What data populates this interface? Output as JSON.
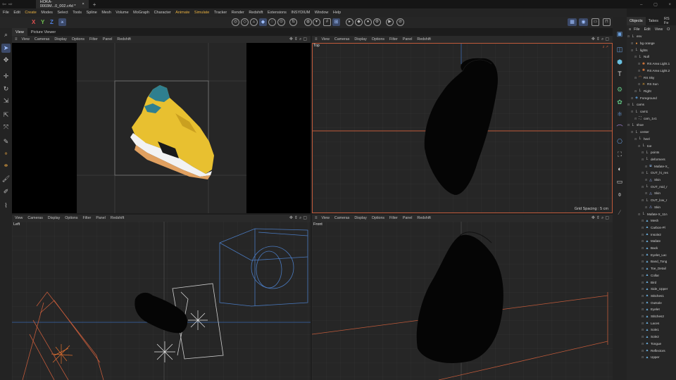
{
  "titlebar": {
    "nav_left": "⇦",
    "nav_right": "⇨",
    "file_tab": "HOKA-0003M...0_002.c4d *",
    "close": "×",
    "new_tab": "+",
    "controls": [
      "–",
      "▢",
      "×"
    ]
  },
  "menu": [
    "File",
    "Edit",
    "Create",
    "Modes",
    "Select",
    "Tools",
    "Spline",
    "Mesh",
    "Volume",
    "MoGraph",
    "Character",
    "Animate",
    "Simulate",
    "Tracker",
    "Render",
    "Redshift",
    "Extensions",
    "INSYDIUM",
    "Window",
    "Help"
  ],
  "menu_highlight": [
    "Create",
    "Animate",
    "Simulate"
  ],
  "toolbar": {
    "axis_x": "X",
    "axis_y": "Y",
    "axis_z": "Z"
  },
  "view_tabs": [
    "View",
    "Picture Viewer"
  ],
  "viewport_menu": [
    "View",
    "Cameras",
    "Display",
    "Options",
    "Filter",
    "Panel",
    "Redshift"
  ],
  "viewports": {
    "top_left": {
      "label": ""
    },
    "top_right": {
      "label": "Top",
      "grid_spacing": "Grid Spacing : 5 cm"
    },
    "bottom_left": {
      "label": "Left"
    },
    "bottom_right": {
      "label": "Front"
    }
  },
  "object_panel": {
    "tabs": [
      "Objects",
      "Takes",
      "RS Fe"
    ],
    "menu": [
      "File",
      "Edit",
      "View",
      "O"
    ],
    "items": [
      {
        "label": "env",
        "depth": 0,
        "icon": "null-icon",
        "color": "#b0b0b0"
      },
      {
        "label": "bg orange",
        "depth": 1,
        "icon": "circle-icon",
        "color": "#e08a3a"
      },
      {
        "label": "lights",
        "depth": 1,
        "icon": "null-icon",
        "color": "#b0b0b0"
      },
      {
        "label": "Null",
        "depth": 2,
        "icon": "null-icon",
        "color": "#b0b0b0"
      },
      {
        "label": "RS Area Light.1",
        "depth": 3,
        "icon": "light-icon",
        "color": "#e07a3a"
      },
      {
        "label": "RS Area Light.2",
        "depth": 3,
        "icon": "light-icon",
        "color": "#e07a3a"
      },
      {
        "label": "RS Sky",
        "depth": 2,
        "icon": "sky-icon",
        "color": "#e07a3a"
      },
      {
        "label": "RS Sun",
        "depth": 3,
        "icon": "sun-icon",
        "color": "#e0a030"
      },
      {
        "label": "Right",
        "depth": 2,
        "icon": "null-icon",
        "color": "#b0b0b0"
      },
      {
        "label": "Foreground",
        "depth": 1,
        "icon": "object-icon",
        "color": "#5aa0e0"
      },
      {
        "label": "cams",
        "depth": 0,
        "icon": "null-icon",
        "color": "#b0b0b0"
      },
      {
        "label": "cam1",
        "depth": 1,
        "icon": "null-icon",
        "color": "#b0b0b0"
      },
      {
        "label": "cam_1v1",
        "depth": 2,
        "icon": "camera-icon",
        "color": "#c8c8c8"
      },
      {
        "label": "shoe",
        "depth": 0,
        "icon": "null-icon",
        "color": "#b0b0b0"
      },
      {
        "label": "center",
        "depth": 1,
        "icon": "null-icon",
        "color": "#b0b0b0"
      },
      {
        "label": "heel",
        "depth": 2,
        "icon": "null-icon",
        "color": "#b0b0b0"
      },
      {
        "label": "toe",
        "depth": 3,
        "icon": "null-icon",
        "color": "#b0b0b0"
      },
      {
        "label": "points",
        "depth": 4,
        "icon": "null-icon",
        "color": "#b0b0b0"
      },
      {
        "label": "deformers",
        "depth": 4,
        "icon": "null-icon",
        "color": "#b0b0b0"
      },
      {
        "label": "Mafate-X_",
        "depth": 5,
        "icon": "deformer-icon",
        "color": "#8ab0e0"
      },
      {
        "label": "OUT_hi_res",
        "depth": 4,
        "icon": "null-icon",
        "color": "#b0b0b0"
      },
      {
        "label": "Skin",
        "depth": 5,
        "icon": "skin-icon",
        "color": "#8aa0e0"
      },
      {
        "label": "OUT_mid_r",
        "depth": 4,
        "icon": "null-icon",
        "color": "#b0b0b0"
      },
      {
        "label": "Skin",
        "depth": 5,
        "icon": "skin-icon",
        "color": "#8aa0e0"
      },
      {
        "label": "OUT_low_r",
        "depth": 4,
        "icon": "null-icon",
        "color": "#b0b0b0"
      },
      {
        "label": "Skin",
        "depth": 5,
        "icon": "skin-icon",
        "color": "#8aa0e0"
      },
      {
        "label": "Mafate-X_11n",
        "depth": 3,
        "icon": "null-icon",
        "color": "#b0b0b0"
      },
      {
        "label": "Mesh",
        "depth": 4,
        "icon": "mesh-icon",
        "color": "#6ab0e0"
      },
      {
        "label": "Carbon-Pl",
        "depth": 4,
        "icon": "mesh-icon",
        "color": "#6ab0e0"
      },
      {
        "label": "Insole2",
        "depth": 4,
        "icon": "mesh-icon",
        "color": "#6ab0e0"
      },
      {
        "label": "Mafate",
        "depth": 4,
        "icon": "mesh-icon",
        "color": "#6ab0e0"
      },
      {
        "label": "Back",
        "depth": 4,
        "icon": "mesh-icon",
        "color": "#6ab0e0"
      },
      {
        "label": "Eyelet_Lac",
        "depth": 4,
        "icon": "mesh-icon",
        "color": "#6ab0e0"
      },
      {
        "label": "Band_Tong",
        "depth": 4,
        "icon": "mesh-icon",
        "color": "#6ab0e0"
      },
      {
        "label": "Toe_Detail",
        "depth": 4,
        "icon": "mesh-icon",
        "color": "#6ab0e0"
      },
      {
        "label": "Collar",
        "depth": 4,
        "icon": "mesh-icon",
        "color": "#6ab0e0"
      },
      {
        "label": "Bird",
        "depth": 4,
        "icon": "mesh-icon",
        "color": "#6ab0e0"
      },
      {
        "label": "Side_Upper",
        "depth": 4,
        "icon": "mesh-icon",
        "color": "#6ab0e0"
      },
      {
        "label": "Stitches1",
        "depth": 4,
        "icon": "mesh-icon",
        "color": "#6ab0e0"
      },
      {
        "label": "Outsole",
        "depth": 4,
        "icon": "mesh-icon",
        "color": "#6ab0e0"
      },
      {
        "label": "Eyelet",
        "depth": 4,
        "icon": "mesh-icon",
        "color": "#6ab0e0"
      },
      {
        "label": "Stitches2",
        "depth": 4,
        "icon": "mesh-icon",
        "color": "#6ab0e0"
      },
      {
        "label": "Laces",
        "depth": 4,
        "icon": "mesh-icon",
        "color": "#6ab0e0"
      },
      {
        "label": "Sole1",
        "depth": 4,
        "icon": "mesh-icon",
        "color": "#6ab0e0"
      },
      {
        "label": "Sole2",
        "depth": 4,
        "icon": "mesh-icon",
        "color": "#6ab0e0"
      },
      {
        "label": "Tongue",
        "depth": 4,
        "icon": "mesh-icon",
        "color": "#6ab0e0"
      },
      {
        "label": "Reflectors",
        "depth": 4,
        "icon": "mesh-icon",
        "color": "#6ab0e0"
      },
      {
        "label": "Upper",
        "depth": 4,
        "icon": "mesh-icon",
        "color": "#6ab0e0"
      }
    ]
  },
  "colors": {
    "accent_orange": "#c05a3a",
    "active_blue": "#3c4a6a",
    "menu_highlight": "#e8b040"
  }
}
